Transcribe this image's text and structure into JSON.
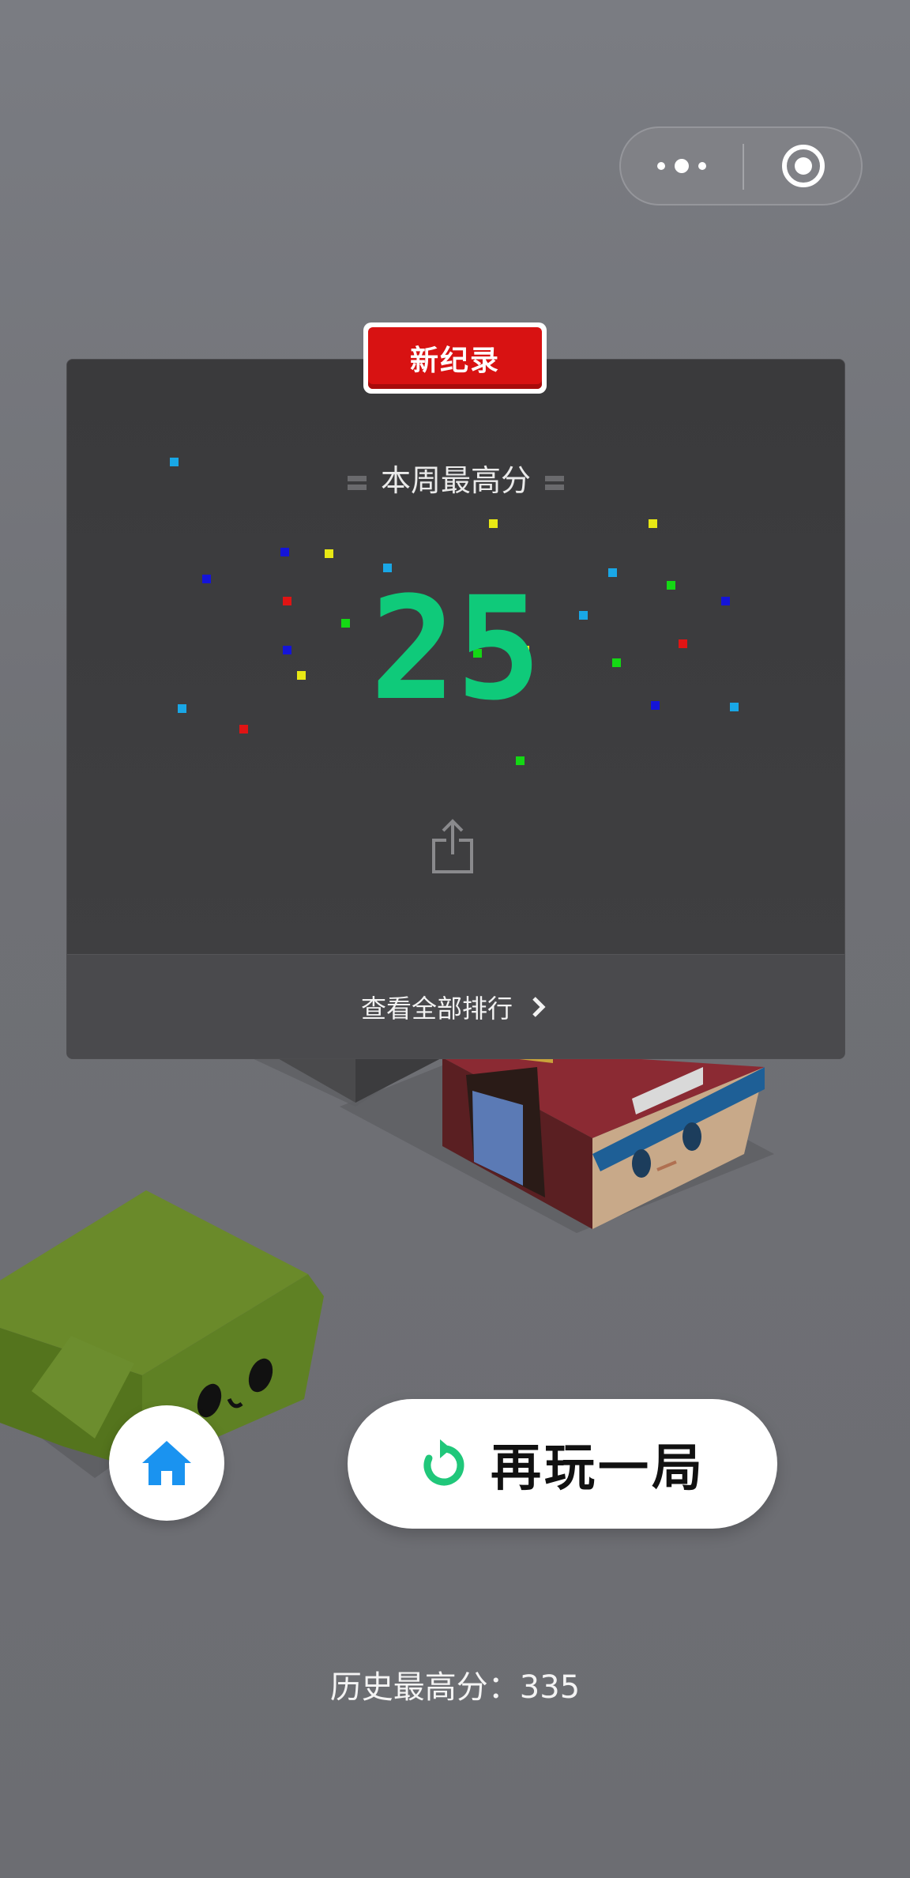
{
  "record_badge": "新纪录",
  "weekly_title": "本周最高分",
  "score": "25",
  "ranking_link": "查看全部排行",
  "replay_label": "再玩一局",
  "history_best": "历史最高分：335",
  "colors": {
    "score_green": "#0fca7a",
    "badge_red": "#d81212",
    "home_blue": "#1a93f0",
    "replay_icon_green": "#20c77a"
  },
  "icons": {
    "capsule_left": "more-dots-icon",
    "capsule_right": "target-circle-icon",
    "share": "share-icon",
    "rank_arrow": "chevron-right-icon",
    "home": "home-icon",
    "replay": "refresh-icon"
  }
}
